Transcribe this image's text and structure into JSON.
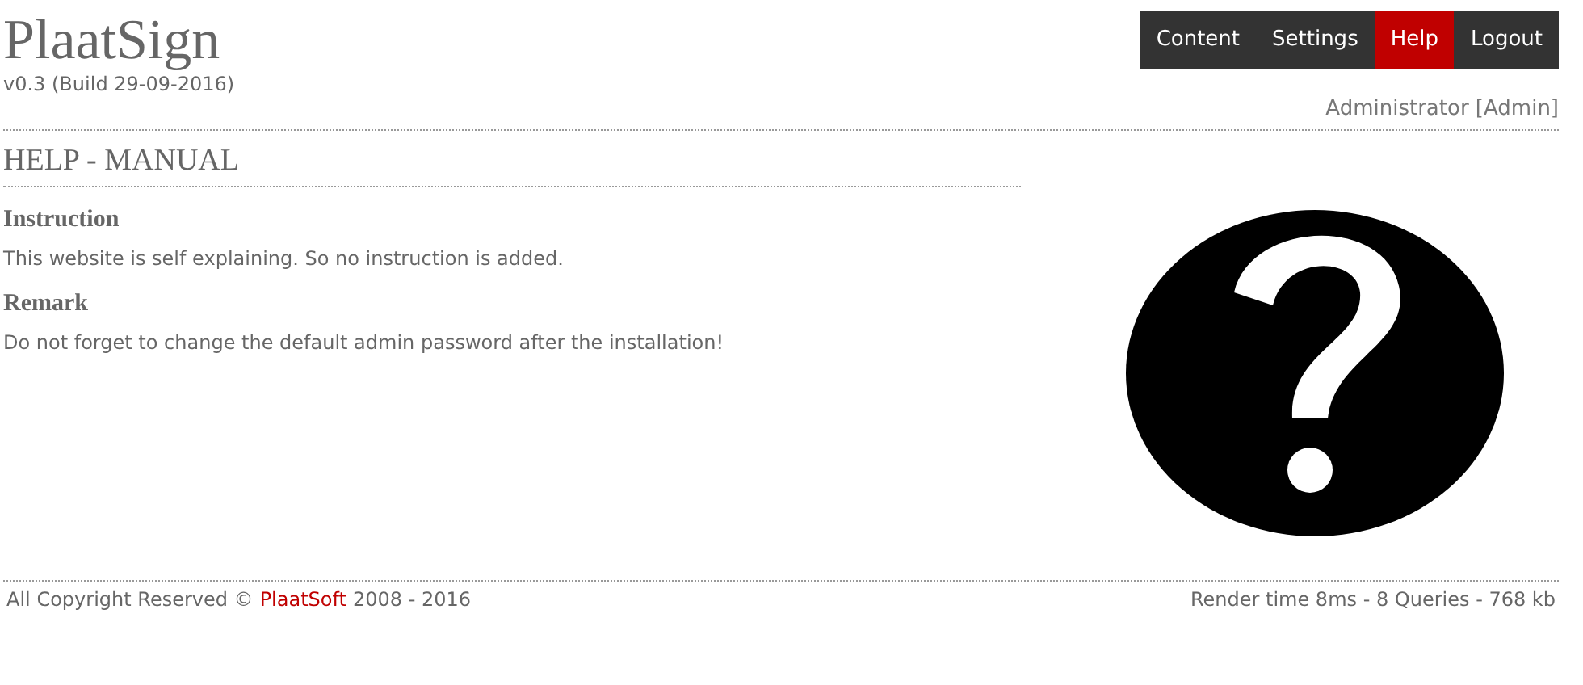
{
  "header": {
    "title": "PlaatSign",
    "version": "v0.3 (Build 29-09-2016)",
    "user": "Administrator [Admin]"
  },
  "menu": [
    {
      "label": "Content",
      "selected": false
    },
    {
      "label": "Settings",
      "selected": false
    },
    {
      "label": "Help",
      "selected": true
    },
    {
      "label": "Logout",
      "selected": false
    }
  ],
  "page_title": "HELP - MANUAL",
  "sections": [
    {
      "heading": "Instruction",
      "text": "This website is self explaining. So no instruction is added."
    },
    {
      "heading": "Remark",
      "text": "Do not forget to change the default admin password after the installation!"
    }
  ],
  "footer": {
    "copyright_prefix": "All Copyright Reserved ©",
    "copyright_link": "PlaatSoft",
    "copyright_suffix": "2008 - 2016",
    "stats": "Render time 8ms - 8 Queries - 768 kb"
  }
}
